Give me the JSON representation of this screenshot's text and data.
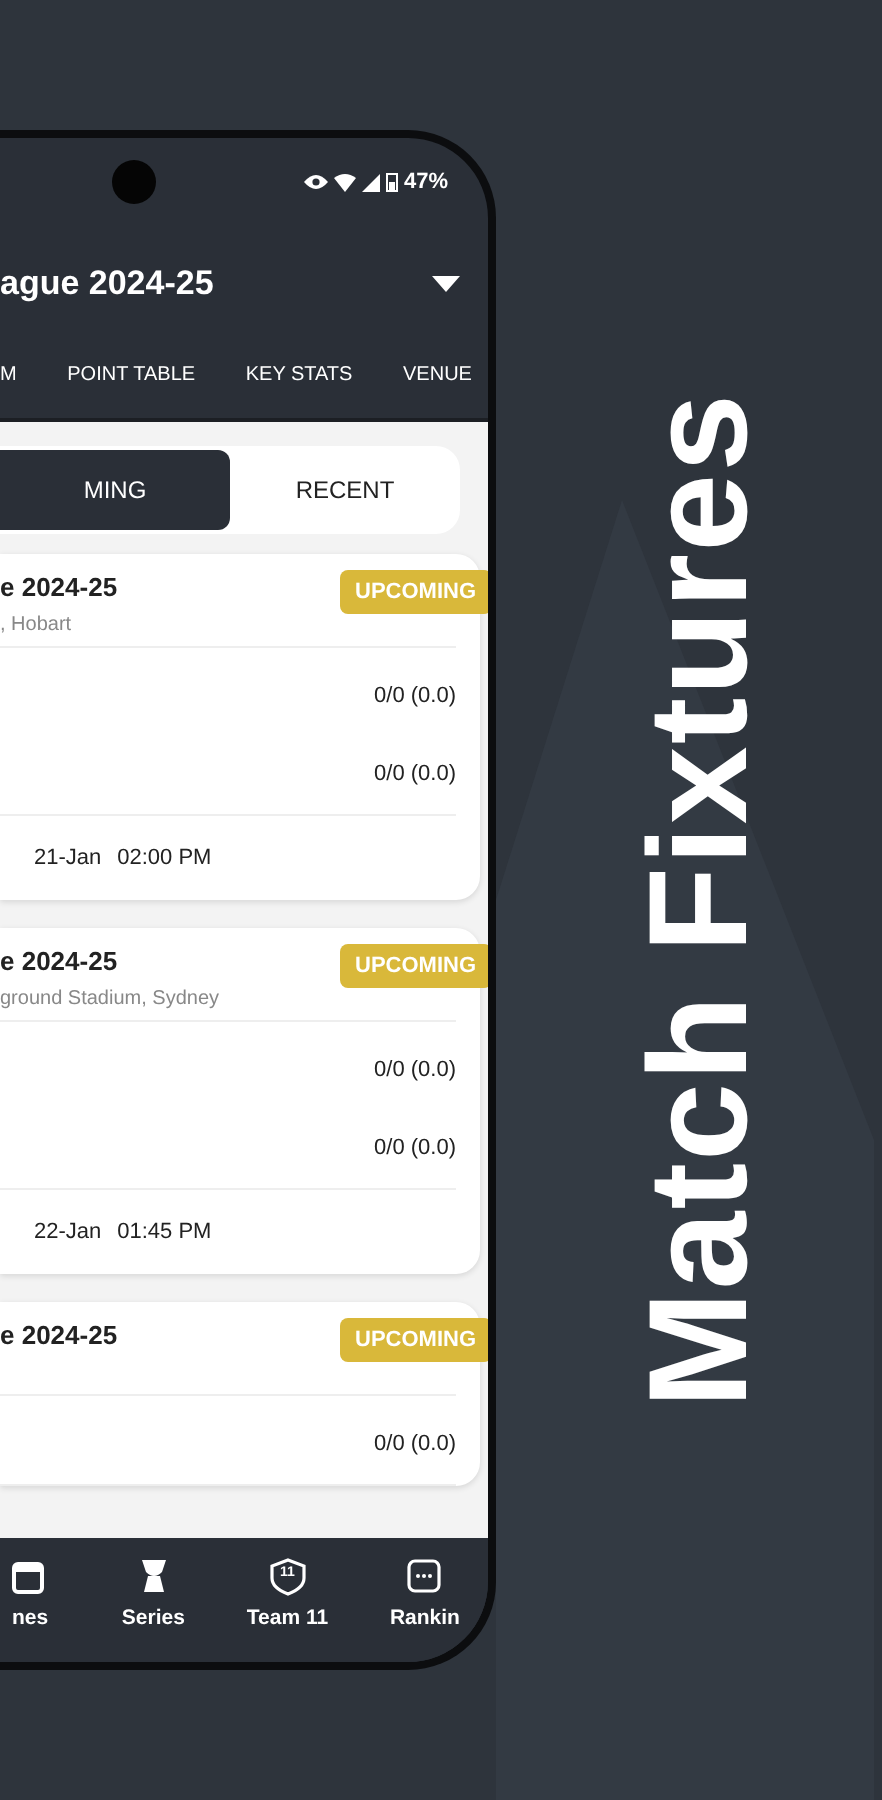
{
  "status_bar": {
    "battery": "47%"
  },
  "header": {
    "title": "ague 2024-25"
  },
  "tabs": [
    {
      "label": "M",
      "selected": false
    },
    {
      "label": "POINT TABLE",
      "selected": false
    },
    {
      "label": "KEY STATS",
      "selected": false
    },
    {
      "label": "VENUE",
      "selected": false
    }
  ],
  "segments": [
    {
      "label": "MING",
      "selected": true
    },
    {
      "label": "RECENT",
      "selected": false
    }
  ],
  "matches": [
    {
      "title": "e 2024-25",
      "venue": ", Hobart",
      "status": "UPCOMING",
      "scores": [
        "0/0 (0.0)",
        "0/0 (0.0)"
      ],
      "date": "21-Jan",
      "time": "02:00 PM"
    },
    {
      "title": "e 2024-25",
      "venue": "ground Stadium, Sydney",
      "status": "UPCOMING",
      "scores": [
        "0/0 (0.0)",
        "0/0 (0.0)"
      ],
      "date": "22-Jan",
      "time": "01:45 PM"
    },
    {
      "title": "e 2024-25",
      "status": "UPCOMING",
      "scores": [
        "0/0 (0.0)"
      ]
    }
  ],
  "nav": [
    {
      "kind": "calendar",
      "label": "nes"
    },
    {
      "kind": "trophy",
      "label": "Series"
    },
    {
      "kind": "shield",
      "label": "Team 11",
      "badge": "11"
    },
    {
      "kind": "chat",
      "label": "Rankin"
    }
  ],
  "promo": {
    "headline": "Match Fixtures"
  }
}
